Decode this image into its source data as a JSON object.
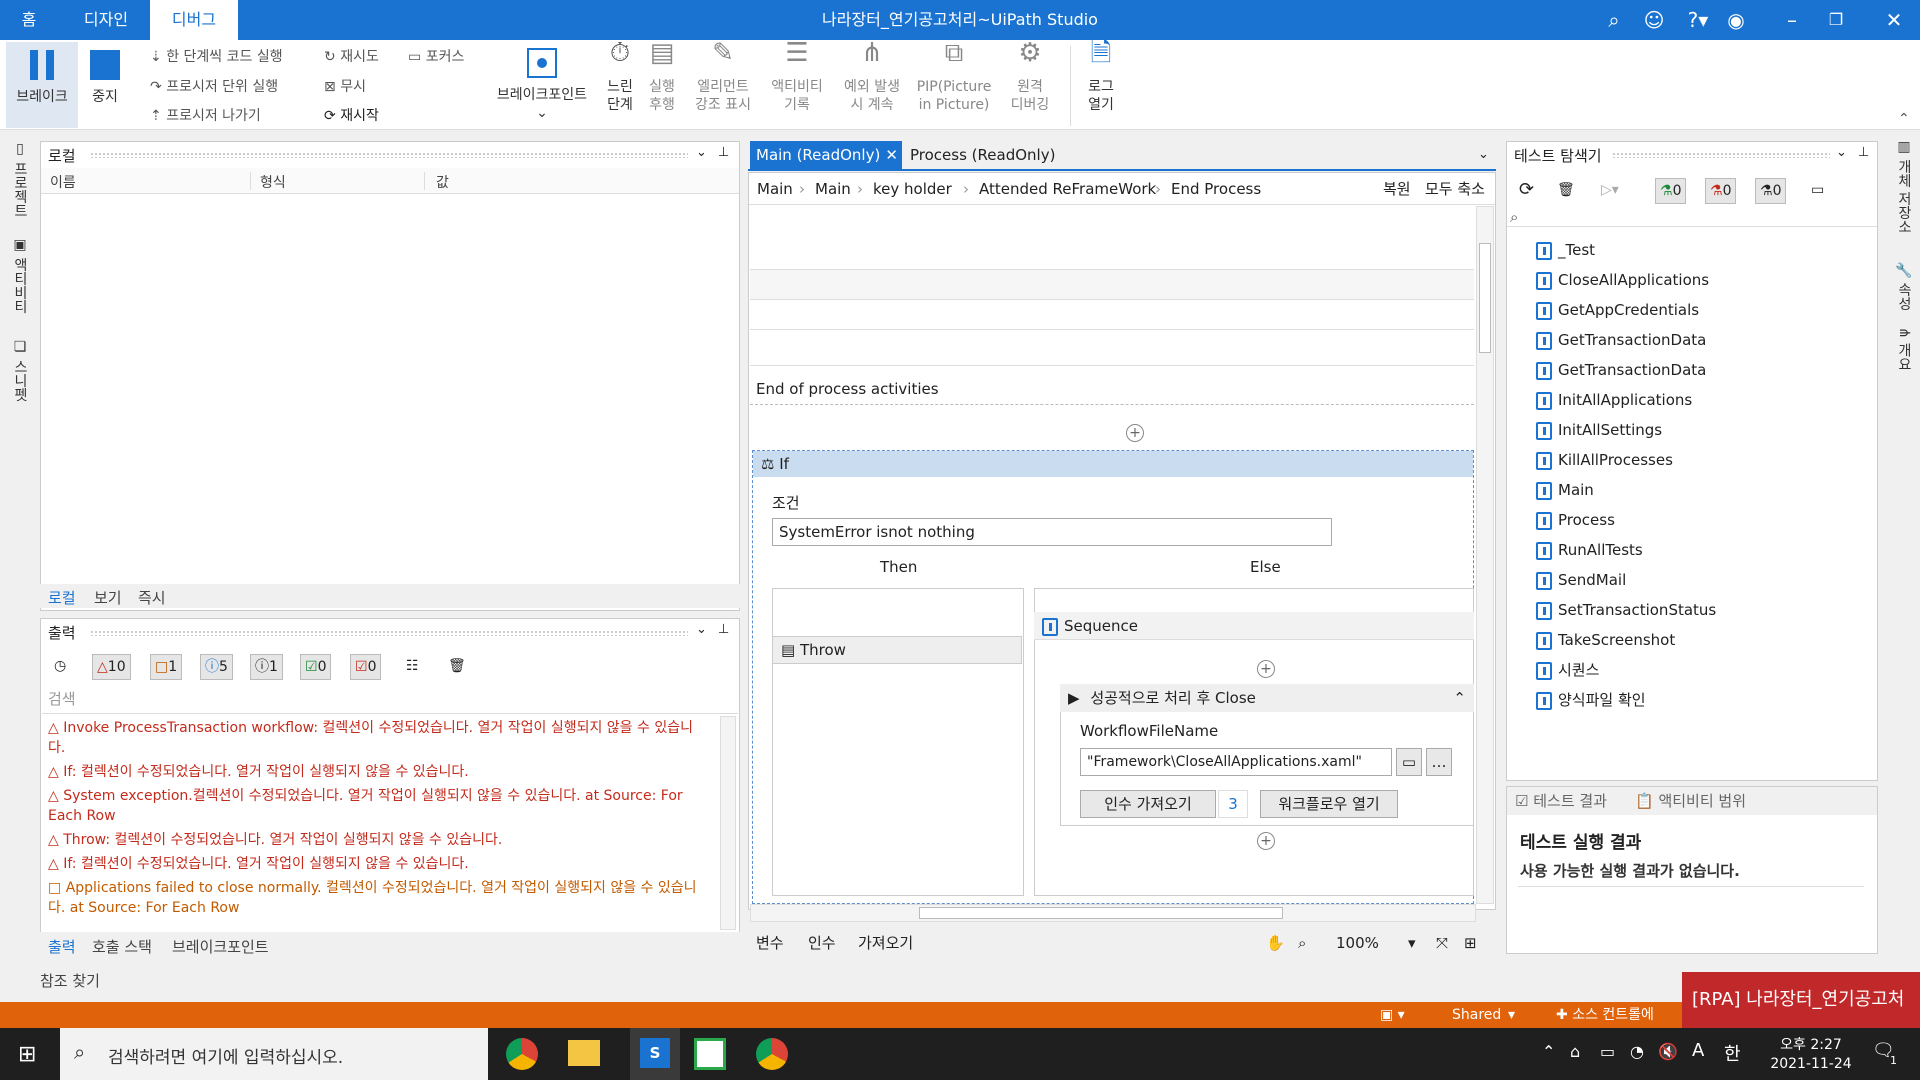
{
  "titlebar": {
    "tabs": [
      "홈",
      "디자인",
      "디버그"
    ],
    "title": "나라장터_연기공고처리~UiPath Studio"
  },
  "ribbon": {
    "break_label": "브레이크",
    "stop_label": "중지",
    "step_into": "한 단계씩 코드 실행",
    "step_over": "프로시저 단위 실행",
    "step_out": "프로시저 나가기",
    "retry": "재시도",
    "ignore": "무시",
    "restart": "재시작",
    "focus": "포커스",
    "breakpoints": "브레이크포인트",
    "slow_step_1": "느린",
    "slow_step_2": "단계",
    "execution_trail_1": "실행",
    "execution_trail_2": "후행",
    "highlight_1": "엘리먼트",
    "highlight_2": "강조 표시",
    "log_activities_1": "액티비티",
    "log_activities_2": "기록",
    "continue_exception_1": "예외 발생",
    "continue_exception_2": "시 계속",
    "pip_1": "PIP(Picture",
    "pip_2": "in Picture)",
    "remote_1": "원격",
    "remote_2": "디버깅",
    "open_logs_1": "로그",
    "open_logs_2": "열기"
  },
  "left_rail": [
    "프로젝트",
    "액티비티",
    "스니펫"
  ],
  "right_rail": [
    "개체 저장소",
    "속성",
    "개요"
  ],
  "locals": {
    "title": "로컬",
    "columns": [
      "이름",
      "형식",
      "값"
    ],
    "tabs": [
      "로컬",
      "보기",
      "즉시"
    ]
  },
  "output": {
    "title": "출력",
    "counts": {
      "errors": "10",
      "warnings": "1",
      "info": "5",
      "trace": "1",
      "success": "0",
      "failed": "0"
    },
    "search_placeholder": "검색",
    "lines": [
      {
        "text": "Invoke ProcessTransaction workflow: 컬렉션이 수정되었습니다. 열거 작업이 실행되지 않을 수 있습니다.",
        "kind": "error"
      },
      {
        "text": "If: 컬렉션이 수정되었습니다. 열거 작업이 실행되지 않을 수 있습니다.",
        "kind": "error"
      },
      {
        "text": "System exception.컬렉션이 수정되었습니다. 열거 작업이 실행되지 않을 수 있습니다. at Source: For Each Row",
        "kind": "error"
      },
      {
        "text": "Throw: 컬렉션이 수정되었습니다. 열거 작업이 실행되지 않을 수 있습니다.",
        "kind": "error"
      },
      {
        "text": "If: 컬렉션이 수정되었습니다. 열거 작업이 실행되지 않을 수 있습니다.",
        "kind": "error"
      },
      {
        "text": "Applications failed to close normally. 컬렉션이 수정되었습니다. 열거 작업이 실행되지 않을 수 있습니다. at Source: For Each Row",
        "kind": "warning"
      }
    ],
    "tabs": [
      "출력",
      "호출 스택",
      "브레이크포인트"
    ]
  },
  "find_refs": "참조 찾기",
  "designer": {
    "tabs": [
      "Main (ReadOnly)",
      "Process (ReadOnly)"
    ],
    "breadcrumb": [
      "Main",
      "Main",
      "key holder",
      "Attended ReFrameWork",
      "End Process"
    ],
    "expand": "복원",
    "collapse": "모두 축소",
    "end_label": "End of process activities",
    "if_title": "If",
    "condition_label": "조건",
    "condition_value": "SystemError isnot nothing",
    "then_label": "Then",
    "else_label": "Else",
    "throw_label": "Throw",
    "sequence_label": "Sequence",
    "invoke_title": "성공적으로 처리 후 Close",
    "wf_label": "WorkflowFileName",
    "wf_value": "\"Framework\\CloseAllApplications.xaml\"",
    "import_args": "인수 가져오기",
    "import_count": "3",
    "open_wf": "워크플로우 열기",
    "bottom_tabs": [
      "변수",
      "인수",
      "가져오기"
    ],
    "zoom": "100%"
  },
  "test_explorer": {
    "title": "테스트 탐색기",
    "counts": [
      "0",
      "0",
      "0"
    ],
    "items": [
      "_Test",
      "CloseAllApplications",
      "GetAppCredentials",
      "GetTransactionData",
      "GetTransactionData",
      "InitAllApplications",
      "InitAllSettings",
      "KillAllProcesses",
      "Main",
      "Process",
      "RunAllTests",
      "SendMail",
      "SetTransactionStatus",
      "TakeScreenshot",
      "시퀀스",
      "양식파일 확인"
    ],
    "bottom_tabs": [
      "테스트 결과",
      "액티비티 범위"
    ],
    "results_title": "테스트 실행 결과",
    "results_msg": "사용 가능한 실행 결과가 없습니다."
  },
  "statusbar": {
    "shared": "Shared",
    "source_control": "소스 컨트롤에",
    "popup": "[RPA] 나라장터_연기공고처"
  },
  "taskbar": {
    "search": "검색하려면 여기에 입력하십시오.",
    "ampm": "오후 2:27",
    "date": "2021-11-24",
    "ime": "한",
    "font": "A",
    "notif": "1"
  }
}
